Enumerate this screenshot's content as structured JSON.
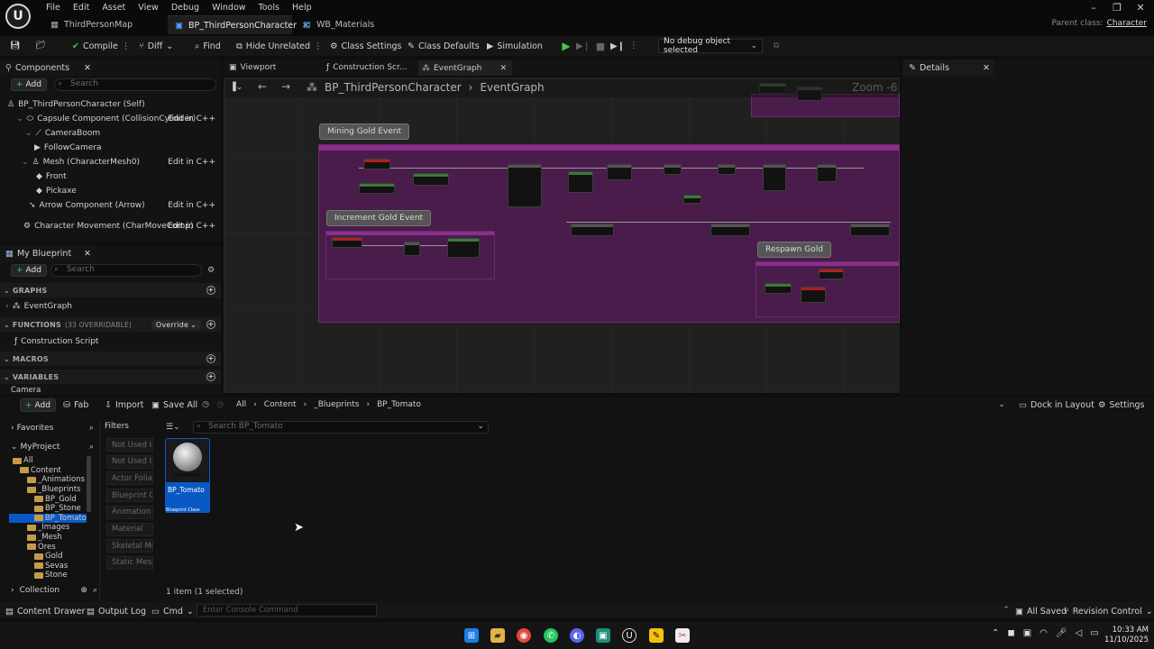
{
  "menu": [
    "File",
    "Edit",
    "Asset",
    "View",
    "Debug",
    "Window",
    "Tools",
    "Help"
  ],
  "tabs": [
    {
      "label": "ThirdPersonMap"
    },
    {
      "label": "BP_ThirdPersonCharacter"
    },
    {
      "label": "WB_Materials"
    }
  ],
  "parent_class": {
    "label": "Parent class:",
    "value": "Character"
  },
  "toolbar": {
    "compile": "Compile",
    "diff": "Diff",
    "find": "Find",
    "hide_unrelated": "Hide Unrelated",
    "class_settings": "Class Settings",
    "class_defaults": "Class Defaults",
    "simulation": "Simulation",
    "debug_object": "No debug object selected"
  },
  "components": {
    "title": "Components",
    "add": "Add",
    "search_placeholder": "Search",
    "items": [
      {
        "label": "BP_ThirdPersonCharacter (Self)",
        "edit": ""
      },
      {
        "label": "Capsule Component (CollisionCylinder)",
        "edit": "Edit in C++"
      },
      {
        "label": "CameraBoom",
        "edit": ""
      },
      {
        "label": "FollowCamera",
        "edit": ""
      },
      {
        "label": "Mesh (CharacterMesh0)",
        "edit": "Edit in C++"
      },
      {
        "label": "Front",
        "edit": ""
      },
      {
        "label": "Pickaxe",
        "edit": ""
      },
      {
        "label": "Arrow Component (Arrow)",
        "edit": "Edit in C++"
      },
      {
        "label": "Character Movement (CharMoveComp)",
        "edit": "Edit in C++"
      }
    ]
  },
  "my_blueprint": {
    "title": "My Blueprint",
    "add": "Add",
    "search_placeholder": "Search",
    "graphs": "GRAPHS",
    "event_graph": "EventGraph",
    "functions": "FUNCTIONS",
    "functions_count": "(33 OVERRIDABLE)",
    "override": "Override",
    "construction_script": "Construction Script",
    "macros": "MACROS",
    "variables": "VARIABLES",
    "camera": "Camera"
  },
  "editor_tabs": {
    "viewport": "Viewport",
    "construction": "Construction Scr...",
    "event_graph": "EventGraph"
  },
  "details": {
    "title": "Details"
  },
  "graph": {
    "breadcrumb_bp": "BP_ThirdPersonCharacter",
    "breadcrumb_graph": "EventGraph",
    "zoom": "Zoom -6",
    "comments": {
      "mining": "Mining Gold Event",
      "increment": "Increment Gold Event",
      "respawn": "Respawn Gold"
    }
  },
  "content_browser": {
    "add": "Add",
    "fab": "Fab",
    "import": "Import",
    "save_all": "Save All",
    "path": [
      "All",
      "Content",
      "_Blueprints",
      "BP_Tomato"
    ],
    "dock": "Dock in Layout",
    "settings": "Settings",
    "favorites": "Favorites",
    "project": "MyProject",
    "filters_title": "Filters",
    "search_placeholder": "Search BP_Tomato",
    "tree": [
      {
        "label": "All",
        "depth": 0
      },
      {
        "label": "Content",
        "depth": 1
      },
      {
        "label": "_Animations",
        "depth": 2
      },
      {
        "label": "_Blueprints",
        "depth": 2
      },
      {
        "label": "BP_Gold",
        "depth": 3
      },
      {
        "label": "BP_Stone",
        "depth": 3
      },
      {
        "label": "BP_Tomato",
        "depth": 3
      },
      {
        "label": "_Images",
        "depth": 2
      },
      {
        "label": "_Mesh",
        "depth": 2
      },
      {
        "label": "Ores",
        "depth": 2
      },
      {
        "label": "Gold",
        "depth": 3
      },
      {
        "label": "Sevas",
        "depth": 3
      },
      {
        "label": "Stone",
        "depth": 3
      }
    ],
    "filters": [
      "Not Used In...",
      "Not Used In...",
      "Actor Foliage",
      "Blueprint Cla...",
      "Animation M...",
      "Material",
      "Skeletal Mes...",
      "Static Mesh"
    ],
    "asset": {
      "name": "BP_Tomato",
      "type": "Blueprint Class"
    },
    "collection": "Collection",
    "count": "1 item (1 selected)"
  },
  "status": {
    "content_drawer": "Content Drawer",
    "output_log": "Output Log",
    "cmd": "Cmd",
    "console_placeholder": "Enter Console Command",
    "all_saved": "All Saved",
    "revision_control": "Revision Control"
  },
  "taskbar": {
    "time": "10:33 AM",
    "date": "11/10/2025"
  },
  "colors": {
    "accent": "#0070e0",
    "comment": "#8a2f8c",
    "selected": "#0a58c4"
  }
}
